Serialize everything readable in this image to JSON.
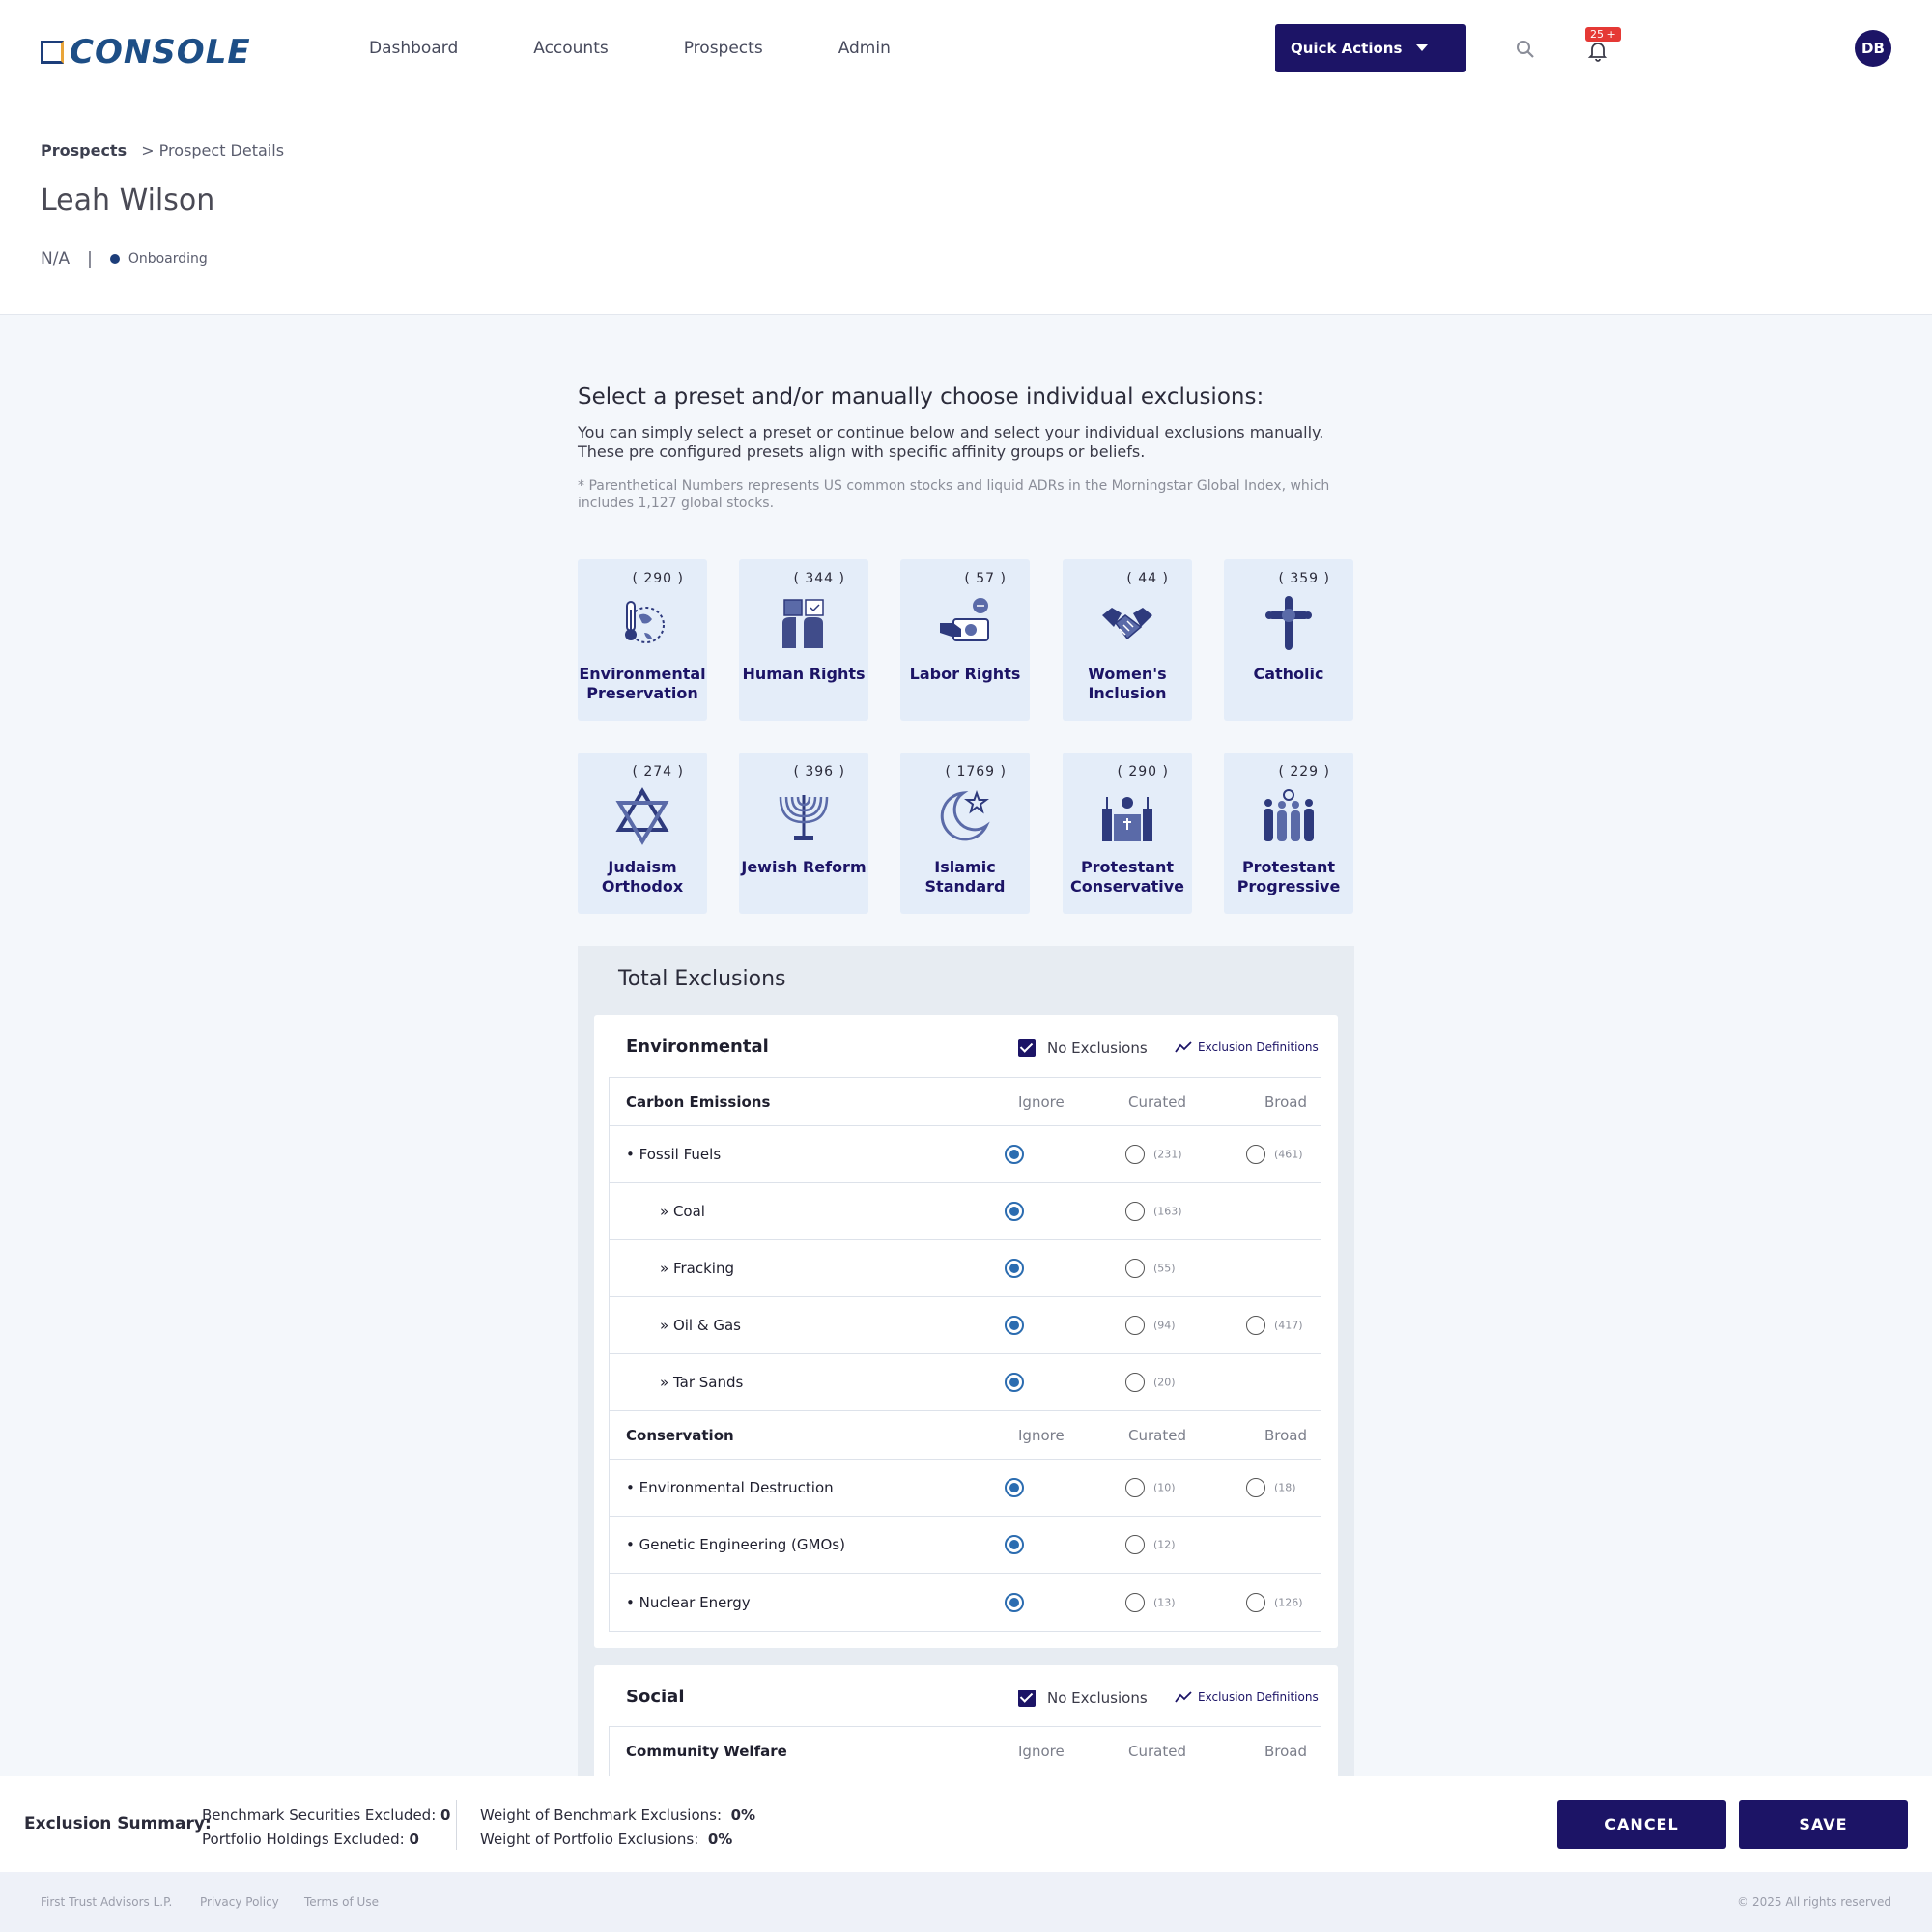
{
  "app": {
    "logo_text": "CONSOLE",
    "nav": [
      "Dashboard",
      "Accounts",
      "Prospects",
      "Admin"
    ],
    "quick_actions_label": "Quick Actions",
    "notification_badge": "25 +",
    "avatar_initials": "DB"
  },
  "breadcrumb": {
    "root": "Prospects",
    "current": "> Prospect Details"
  },
  "prospect": {
    "name": "Leah Wilson",
    "meta": "N/A",
    "separator": "|",
    "status": "Onboarding"
  },
  "intro": {
    "title": "Select a preset and/or manually choose individual exclusions:",
    "text": "You can simply select a preset or continue below and select your individual exclusions manually. These pre configured presets align with specific affinity groups or beliefs.",
    "note": "* Parenthetical Numbers represents US common stocks and liquid ADRs in the Morningstar Global Index, which includes 1,127 global stocks."
  },
  "presets": [
    {
      "count": "( 290 )",
      "label": "Environmental Preservation",
      "icon": "globe-thermometer-icon"
    },
    {
      "count": "( 344 )",
      "label": "Human Rights",
      "icon": "raised-hands-icon"
    },
    {
      "count": "( 57 )",
      "label": "Labor Rights",
      "icon": "hand-money-icon"
    },
    {
      "count": "( 44 )",
      "label": "Women's Inclusion",
      "icon": "handshake-icon"
    },
    {
      "count": "( 359 )",
      "label": "Catholic",
      "icon": "cross-icon"
    },
    {
      "count": "( 274 )",
      "label": "Judaism Orthodox",
      "icon": "star-of-david-icon"
    },
    {
      "count": "( 396 )",
      "label": "Jewish Reform",
      "icon": "menorah-icon"
    },
    {
      "count": "( 1769 )",
      "label": "Islamic Standard",
      "icon": "crescent-star-icon"
    },
    {
      "count": "( 290 )",
      "label": "Protestant Conservative",
      "icon": "pulpit-icon"
    },
    {
      "count": "( 229 )",
      "label": "Protestant Progressive",
      "icon": "congregation-icon"
    }
  ],
  "total_exclusions": {
    "title": "Total Exclusions",
    "no_exclusions_label": "No Exclusions",
    "definitions_label": "Exclusion Definitions",
    "columns": [
      "Ignore",
      "Curated",
      "Broad"
    ],
    "environmental": {
      "title": "Environmental",
      "groups": [
        {
          "name": "Carbon Emissions",
          "rows": [
            {
              "name": "• Fossil Fuels",
              "sub": false,
              "curated": "(231)",
              "broad": "(461)"
            },
            {
              "name": "» Coal",
              "sub": true,
              "curated": "(163)",
              "broad": null
            },
            {
              "name": "» Fracking",
              "sub": true,
              "curated": "(55)",
              "broad": null
            },
            {
              "name": "» Oil & Gas",
              "sub": true,
              "curated": "(94)",
              "broad": "(417)"
            },
            {
              "name": "» Tar Sands",
              "sub": true,
              "curated": "(20)",
              "broad": null
            }
          ]
        },
        {
          "name": "Conservation",
          "rows": [
            {
              "name": "• Environmental Destruction",
              "sub": false,
              "curated": "(10)",
              "broad": "(18)"
            },
            {
              "name": "• Genetic Engineering (GMOs)",
              "sub": false,
              "curated": "(12)",
              "broad": null
            },
            {
              "name": "• Nuclear Energy",
              "sub": false,
              "curated": "(13)",
              "broad": "(126)"
            }
          ]
        }
      ]
    },
    "social": {
      "title": "Social",
      "first_group": "Community Welfare"
    }
  },
  "summary": {
    "title": "Exclusion Summary:",
    "benchmark_securities_label": "Benchmark Securities Excluded:",
    "benchmark_securities_value": "0",
    "portfolio_holdings_label": "Portfolio Holdings Excluded:",
    "portfolio_holdings_value": "0",
    "weight_benchmark_label": "Weight of Benchmark Exclusions:",
    "weight_benchmark_value": "0%",
    "weight_portfolio_label": "Weight of Portfolio Exclusions:",
    "weight_portfolio_value": "0%",
    "cancel_label": "CANCEL",
    "save_label": "SAVE"
  },
  "footer": {
    "company": "First Trust Advisors L.P.",
    "privacy": "Privacy Policy",
    "terms": "Terms of Use",
    "copyright": "© 2025 All rights reserved"
  },
  "colors": {
    "brand": "#1c1466",
    "card_bg": "#e4edf9",
    "radio_on": "#2b6cb0"
  }
}
